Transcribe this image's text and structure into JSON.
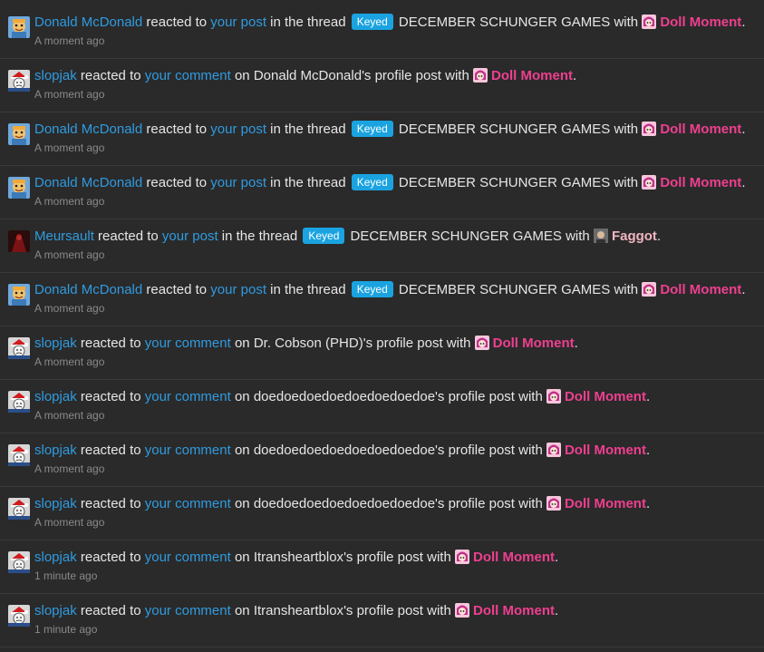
{
  "reactions": {
    "doll_moment": {
      "label": "Doll Moment",
      "color": "#ef3f8f",
      "icon": "doll-moment-icon"
    },
    "faggot": {
      "label": "Faggot",
      "color": "#f2b6c0",
      "icon": "faggot-reaction-icon"
    }
  },
  "common": {
    "reacted_to": " reacted to ",
    "in_the_thread": " in the thread ",
    "on": " on ",
    "with": " with ",
    "profile_post_with": "'s profile post with ",
    "your_post": "your post",
    "your_comment": "your comment",
    "thread_prefix": "Keyed",
    "thread_title": "DECEMBER SCHUNGER GAMES",
    "period": "."
  },
  "notifications": [
    {
      "user": "Donald McDonald",
      "user_link": true,
      "kind": "thread",
      "reaction": "Doll Moment",
      "time": "A moment ago"
    },
    {
      "user": "slopjak",
      "user_link": true,
      "kind": "profile",
      "profile_owner": "Donald McDonald",
      "reaction": "Doll Moment",
      "time": "A moment ago"
    },
    {
      "user": "Donald McDonald",
      "user_link": true,
      "kind": "thread",
      "reaction": "Doll Moment",
      "time": "A moment ago"
    },
    {
      "user": "Donald McDonald",
      "user_link": true,
      "kind": "thread",
      "reaction": "Doll Moment",
      "time": "A moment ago"
    },
    {
      "user": "Meursault",
      "user_link": true,
      "kind": "thread",
      "reaction": "Faggot",
      "time": "A moment ago"
    },
    {
      "user": "Donald McDonald",
      "user_link": true,
      "kind": "thread",
      "reaction": "Doll Moment",
      "time": "A moment ago"
    },
    {
      "user": "slopjak",
      "user_link": true,
      "kind": "profile",
      "profile_owner": "Dr. Cobson (PHD)",
      "reaction": "Doll Moment",
      "time": "A moment ago"
    },
    {
      "user": "slopjak",
      "user_link": true,
      "kind": "profile",
      "profile_owner": "doedoedoedoedoedoedoedoe",
      "reaction": "Doll Moment",
      "time": "A moment ago"
    },
    {
      "user": "slopjak",
      "user_link": true,
      "kind": "profile",
      "profile_owner": "doedoedoedoedoedoedoedoe",
      "reaction": "Doll Moment",
      "time": "A moment ago"
    },
    {
      "user": "slopjak",
      "user_link": true,
      "kind": "profile",
      "profile_owner": "doedoedoedoedoedoedoedoe",
      "reaction": "Doll Moment",
      "time": "A moment ago"
    },
    {
      "user": "slopjak",
      "user_link": true,
      "kind": "profile",
      "profile_owner": "Itransheartblox",
      "reaction": "Doll Moment",
      "time": "1 minute ago"
    },
    {
      "user": "slopjak",
      "user_link": true,
      "kind": "profile",
      "profile_owner": "Itransheartblox",
      "reaction": "Doll Moment",
      "time": "1 minute ago"
    }
  ],
  "avatars": {
    "Donald McDonald": "donald-mcdonald-avatar",
    "slopjak": "slopjak-avatar",
    "Meursault": "meursault-avatar"
  }
}
